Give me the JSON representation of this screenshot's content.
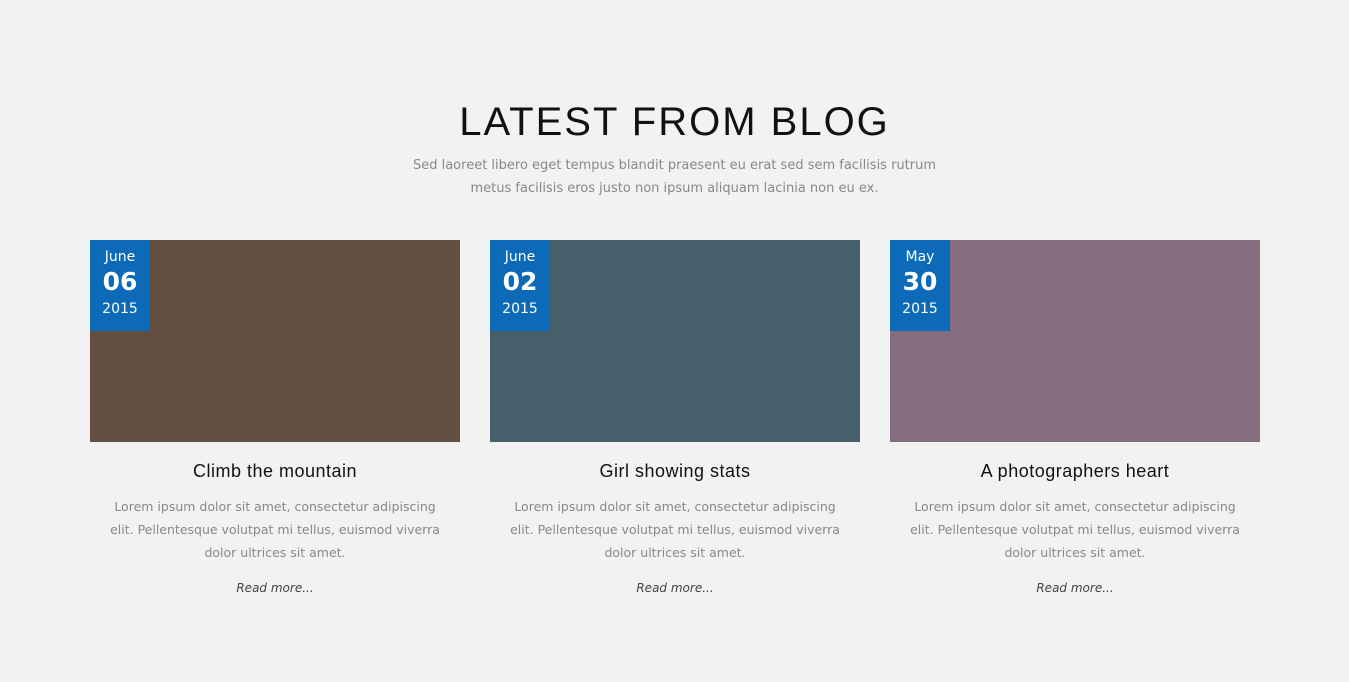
{
  "section": {
    "title": "LATEST FROM BLOG",
    "subtitle": "Sed laoreet libero eget tempus blandit praesent eu erat sed sem facilisis rutrum metus facilisis eros justo non ipsum aliquam lacinia non eu ex."
  },
  "colors": {
    "background": "#f2f2f2",
    "badge": "#0c6ab8"
  },
  "posts": [
    {
      "month": "June",
      "day": "06",
      "year": "2015",
      "image_color": "#634f41",
      "title": "Climb the mountain",
      "excerpt": "Lorem ipsum dolor sit amet, consectetur adipiscing elit. Pellentesque volutpat mi tellus, euismod viverra dolor ultrices sit amet.",
      "read_more": "Read more..."
    },
    {
      "month": "June",
      "day": "02",
      "year": "2015",
      "image_color": "#46606b",
      "title": "Girl showing stats",
      "excerpt": "Lorem ipsum dolor sit amet, consectetur adipiscing elit. Pellentesque volutpat mi tellus, euismod viverra dolor ultrices sit amet.",
      "read_more": "Read more..."
    },
    {
      "month": "May",
      "day": "30",
      "year": "2015",
      "image_color": "#846e7f",
      "title": "A photographers heart",
      "excerpt": "Lorem ipsum dolor sit amet, consectetur adipiscing elit. Pellentesque volutpat mi tellus, euismod viverra dolor ultrices sit amet.",
      "read_more": "Read more..."
    }
  ]
}
